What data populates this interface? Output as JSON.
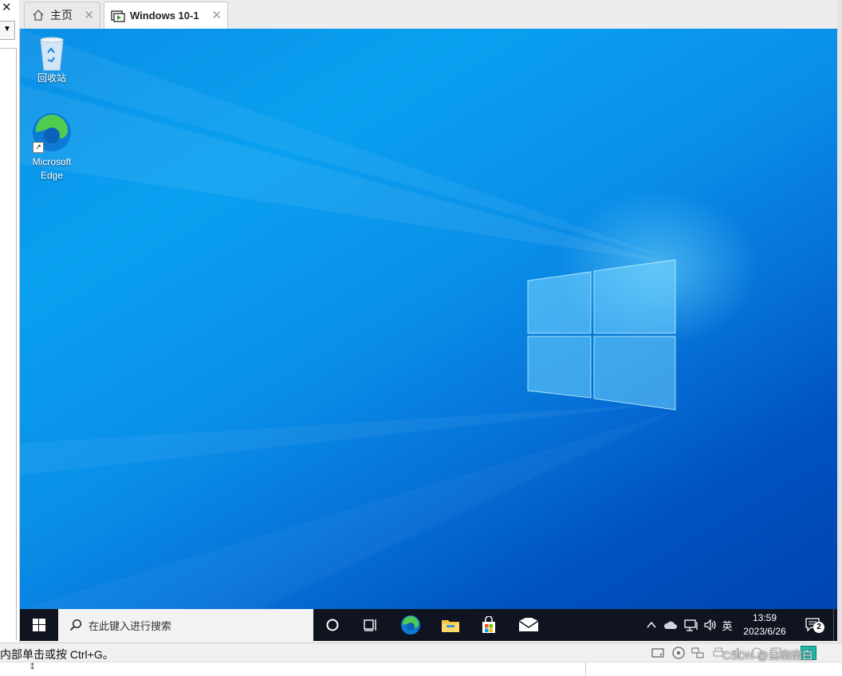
{
  "left_panel": {
    "close_label": "✕",
    "dropdown_arrow": "▼"
  },
  "tabs": [
    {
      "label": "主页",
      "icon": "home-icon",
      "close": "✕"
    },
    {
      "label": "Windows 10-1",
      "icon": "vm-icon",
      "close": "✕"
    }
  ],
  "desktop": {
    "icons": [
      {
        "label": "回收站",
        "icon": "recycle-bin-icon"
      },
      {
        "label": "Microsoft Edge",
        "icon": "edge-icon"
      }
    ]
  },
  "taskbar": {
    "search_placeholder": "在此键入进行搜索",
    "pinned": [
      "cortana-icon",
      "task-view-icon",
      "edge-icon",
      "file-explorer-icon",
      "store-icon",
      "mail-icon"
    ],
    "tray": {
      "chevron": "^",
      "ime": "英",
      "time": "13:59",
      "date": "2023/6/26",
      "notification_count": "2"
    }
  },
  "status": {
    "hint": "内部单击或按 Ctrl+G。",
    "watermark": "CSDN @白幽幽白"
  },
  "colors": {
    "taskbar": "#0f1420",
    "desktop_blue": "#0a8fe6",
    "edge_green": "#4fcc4f"
  }
}
